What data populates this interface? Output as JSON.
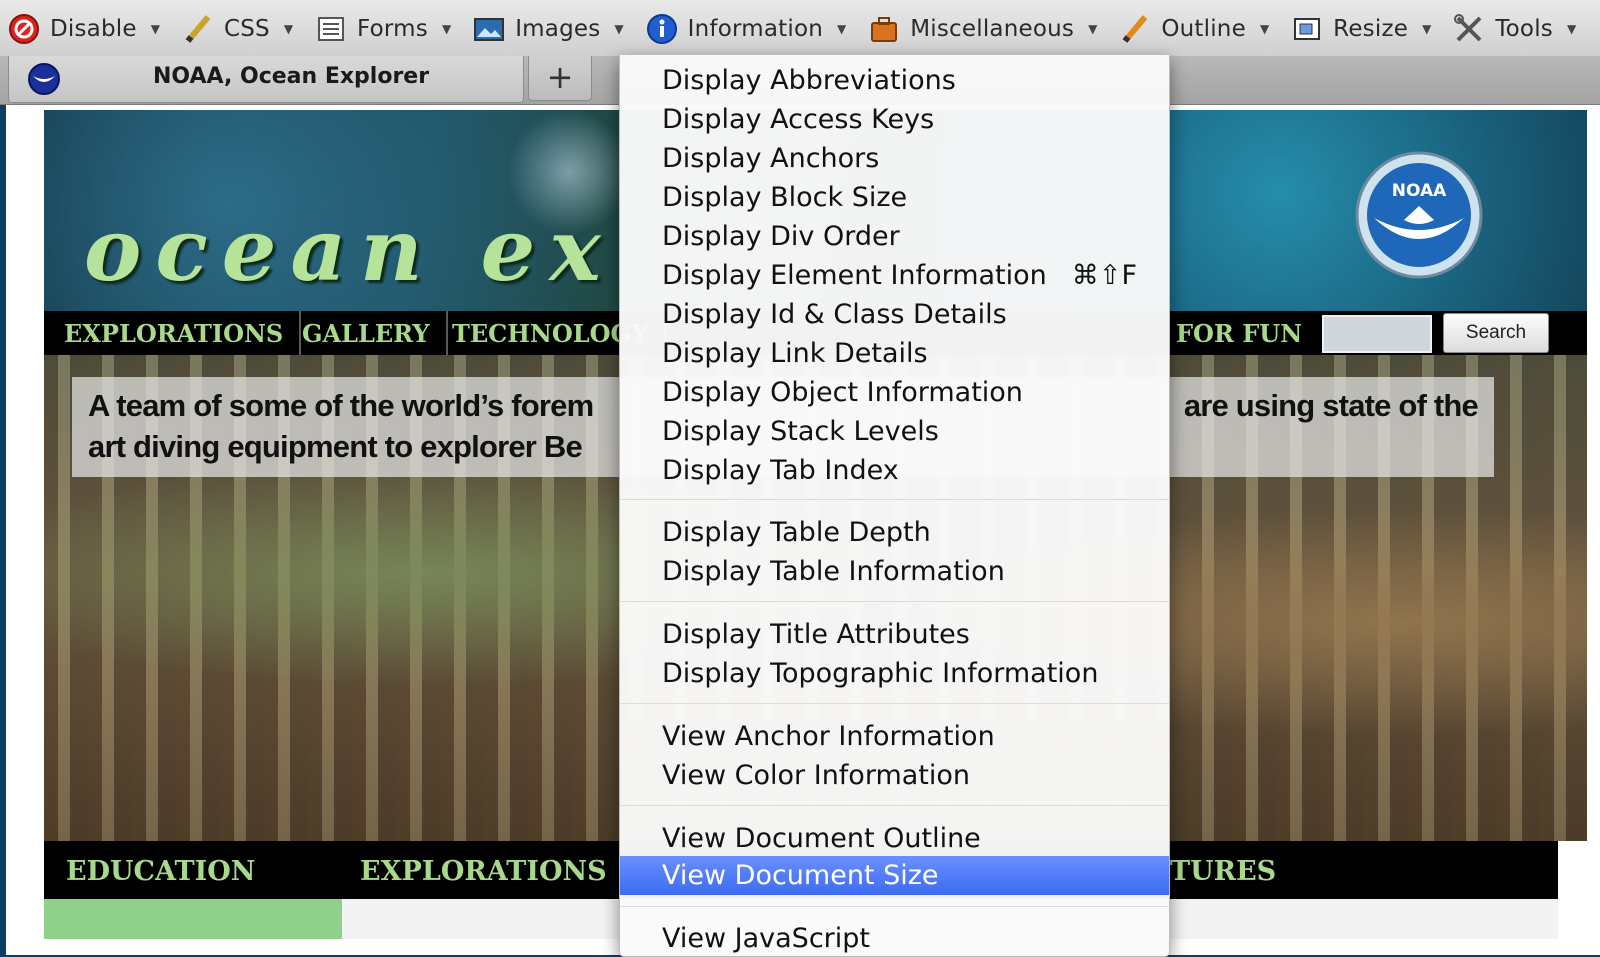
{
  "toolbar": {
    "items": [
      {
        "label": "Disable",
        "icon": "disable-icon"
      },
      {
        "label": "CSS",
        "icon": "css-pencil-icon"
      },
      {
        "label": "Forms",
        "icon": "forms-icon"
      },
      {
        "label": "Images",
        "icon": "images-icon"
      },
      {
        "label": "Information",
        "icon": "info-icon"
      },
      {
        "label": "Miscellaneous",
        "icon": "miscellaneous-icon"
      },
      {
        "label": "Outline",
        "icon": "outline-pencil-icon"
      },
      {
        "label": "Resize",
        "icon": "resize-icon"
      },
      {
        "label": "Tools",
        "icon": "tools-icon"
      }
    ],
    "caret": "▼"
  },
  "tabs": {
    "active_title": "NOAA, Ocean Explorer",
    "new_tab": "+"
  },
  "page": {
    "banner_title": "ocean ex",
    "noaa_logo_text": "NOAA",
    "topnav": [
      "EXPLORATIONS",
      "GALLERY",
      "TECHNOLOGY",
      "FOR FUN"
    ],
    "search_button": "Search",
    "caption_line1": "A team of some of the world’s forem",
    "caption_line1_end": "are using state of the",
    "caption_line2": "art diving equipment to explorer Be",
    "botnav": [
      "EDUCATION",
      "EXPLORATIONS",
      "TURES"
    ]
  },
  "menu": {
    "items": [
      {
        "label": "Display Abbreviations"
      },
      {
        "label": "Display Access Keys"
      },
      {
        "label": "Display Anchors"
      },
      {
        "label": "Display Block Size"
      },
      {
        "label": "Display Div Order"
      },
      {
        "label": "Display Element Information",
        "shortcut": "⌘⇧F"
      },
      {
        "label": "Display Id & Class Details"
      },
      {
        "label": "Display Link Details"
      },
      {
        "label": "Display Object Information"
      },
      {
        "label": "Display Stack Levels"
      },
      {
        "label": "Display Tab Index"
      },
      {
        "label": "Display Table Depth"
      },
      {
        "label": "Display Table Information"
      },
      {
        "label": "Display Title Attributes"
      },
      {
        "label": "Display Topographic Information"
      },
      {
        "label": "View Anchor Information"
      },
      {
        "label": "View Color Information"
      },
      {
        "label": "View Document Outline"
      },
      {
        "label": "View Document Size",
        "selected": true
      },
      {
        "label": "View JavaScript"
      }
    ],
    "selected_color": "#3d6cf2"
  },
  "colors": {
    "nav_text": "#a8d98a",
    "background": "#0a3f64"
  }
}
